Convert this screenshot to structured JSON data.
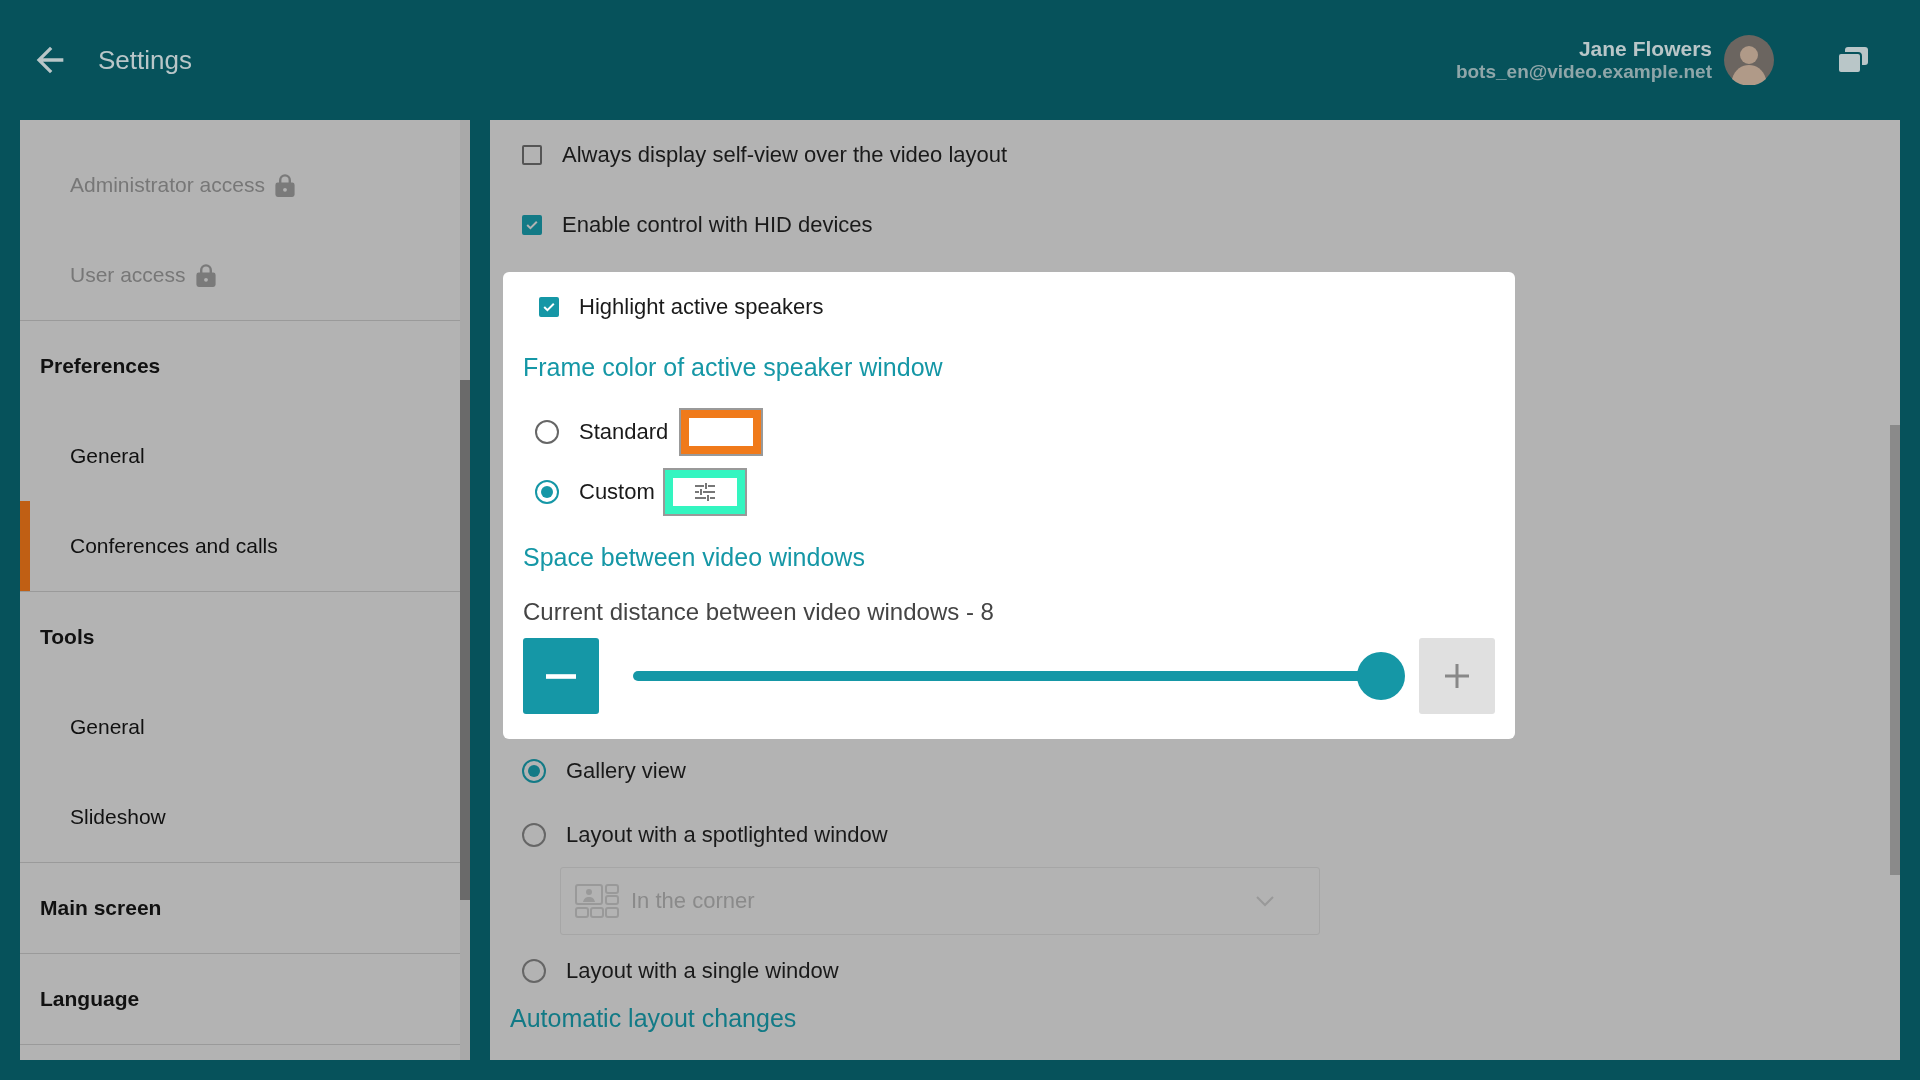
{
  "header": {
    "title": "Settings",
    "user": {
      "name": "Jane Flowers",
      "email": "bots_en@video.example.net"
    }
  },
  "sidebar": {
    "sections": [
      {
        "items": [
          {
            "label": "Administrator access",
            "locked": true,
            "selected": false
          },
          {
            "label": "User access",
            "locked": true,
            "selected": false
          }
        ]
      },
      {
        "title": "Preferences",
        "items": [
          {
            "label": "General",
            "locked": false,
            "selected": false
          },
          {
            "label": "Conferences and calls",
            "locked": false,
            "selected": true
          }
        ]
      },
      {
        "title": "Tools",
        "items": [
          {
            "label": "General",
            "locked": false,
            "selected": false
          },
          {
            "label": "Slideshow",
            "locked": false,
            "selected": false
          }
        ]
      },
      {
        "title": "Main screen"
      },
      {
        "title": "Language"
      }
    ]
  },
  "options": [
    {
      "label": "Always display self-view over the video layout",
      "checked": false
    },
    {
      "label": "Enable control with HID devices",
      "checked": true
    }
  ],
  "card": {
    "highlight": {
      "label": "Highlight active speakers",
      "checked": true
    },
    "frame_heading": "Frame color of active speaker window",
    "frame_options": [
      {
        "label": "Standard",
        "selected": false,
        "kind": "preset",
        "color": "#f07a1a"
      },
      {
        "label": "Custom",
        "selected": true,
        "kind": "custom",
        "color": "#33f5c0"
      }
    ],
    "spacing_heading": "Space between video windows",
    "spacing": {
      "reading": "Current distance between video windows - 8",
      "level": 1,
      "minus_disabled": false,
      "plus_disabled": true
    }
  },
  "layouts": [
    {
      "label": "Gallery view",
      "selected": true
    },
    {
      "label": "Layout with a spotlighted window",
      "selected": false,
      "dropdown": {
        "value": "In the corner",
        "disabled": true
      }
    },
    {
      "label": "Layout with a single window",
      "selected": false
    }
  ],
  "next_heading": "Automatic layout changes"
}
